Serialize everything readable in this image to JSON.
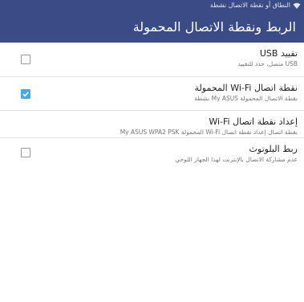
{
  "status_bar": {
    "text": "النطاق أو نقطة الاتصال نشطة",
    "icon": "wifi-hotspot-icon"
  },
  "header": {
    "title": "الربط ونقطة الاتصال المحمولة"
  },
  "items": [
    {
      "title": "تقييد USB",
      "subtitle": "USB متصل، حدد للتقييد",
      "checkbox": true,
      "checked": false
    },
    {
      "title": "نقطة اتصال Wi-Fi المحمولة",
      "subtitle": "نقطة الاتصال المحمولة My ASUS نشطة",
      "checkbox": true,
      "checked": true
    },
    {
      "title": "إعداد نقطة اتصال Wi-Fi",
      "subtitle": "نقطة اتصال إعداد نقطة اتصال Wi-Fi المحمولة My ASUS WPA2 PSK",
      "checkbox": false
    },
    {
      "title": "ربط البلوتوث",
      "subtitle": "عدم مشاركة الاتصال بالإنترنت لهذا الجهاز اللوحي",
      "checkbox": true,
      "checked": false
    }
  ],
  "colors": {
    "header_bg": "#3b4b86",
    "checkbox_checked": "#4aa8de"
  }
}
